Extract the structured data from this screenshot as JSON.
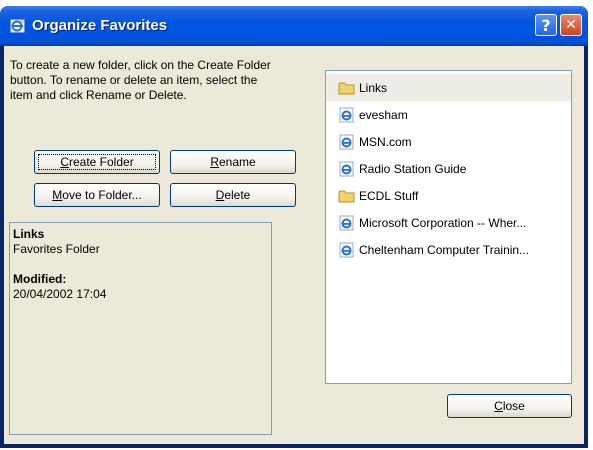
{
  "window": {
    "title": "Organize Favorites",
    "help_glyph": "?",
    "close_glyph": "✕"
  },
  "description": "To create a new folder, click on the Create Folder button. To rename or delete an item, select the item and click Rename or Delete.",
  "buttons": {
    "create_folder": {
      "mnemonic": "C",
      "rest": "reate Folder"
    },
    "rename": {
      "mnemonic": "R",
      "rest": "ename"
    },
    "move_to_folder": {
      "mnemonic": "M",
      "rest": "ove to Folder..."
    },
    "delete": {
      "mnemonic": "D",
      "rest": "elete"
    },
    "close": {
      "mnemonic": "C",
      "rest": "lose"
    }
  },
  "info": {
    "name": "Links",
    "type": "Favorites Folder",
    "modified_label": "Modified:",
    "modified_value": "20/04/2002 17:04"
  },
  "favorites": [
    {
      "label": "Links",
      "icon": "folder-icon",
      "selected": true
    },
    {
      "label": "evesham",
      "icon": "ie-page-icon"
    },
    {
      "label": "MSN.com",
      "icon": "ie-page-icon"
    },
    {
      "label": "Radio Station Guide",
      "icon": "ie-page-icon"
    },
    {
      "label": "ECDL Stuff",
      "icon": "folder-icon"
    },
    {
      "label": "Microsoft Corporation -- Wher...",
      "icon": "ie-page-icon"
    },
    {
      "label": "Cheltenham Computer Trainin...",
      "icon": "ie-page-icon"
    }
  ],
  "colors": {
    "titlebar": "#0054e3",
    "dialog_bg": "#ece9d8",
    "button_border": "#003c74",
    "folder": "#f2d36b",
    "ie_blue": "#2a6fd6"
  }
}
